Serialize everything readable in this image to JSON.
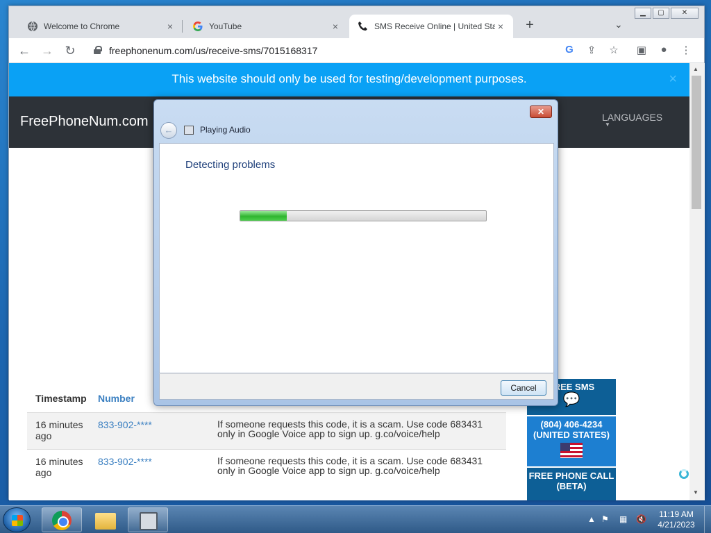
{
  "browser": {
    "tabs": [
      {
        "title": "Welcome to Chrome",
        "icon": "globe-icon",
        "close": "×"
      },
      {
        "title": "YouTube",
        "icon": "google-icon",
        "close": "×"
      },
      {
        "title": "SMS Receive Online | United Stat",
        "icon": "phone-icon",
        "close": "×"
      }
    ],
    "new_tab": "+",
    "url": "freephonenum.com/us/receive-sms/7015168317"
  },
  "page": {
    "banner_text": "This website should only be used for testing/development purposes.",
    "banner_close": "×",
    "brand": "FreePhoneNum.com",
    "languages": "LANGUAGES",
    "table": {
      "headers": [
        "Timestamp",
        "Number"
      ],
      "rows": [
        {
          "timestamp": "16 minutes ago",
          "number": "833-902-****",
          "message": "If someone requests this code, it is a scam. Use code 683431 only in Google Voice app to sign up. g.co/voice/help"
        },
        {
          "timestamp": "16 minutes ago",
          "number": "833-902-****",
          "message": "If someone requests this code, it is a scam. Use code 683431 only in Google Voice app to sign up. g.co/voice/help"
        }
      ]
    },
    "ads": {
      "free_sms": "FREE SMS",
      "phone": "(804) 406-4234",
      "country": "(UNITED STATES)",
      "free_call": "FREE PHONE CALL (BETA)"
    }
  },
  "dialog": {
    "title": "Playing Audio",
    "heading": "Detecting problems",
    "progress": 0.19,
    "cancel_label": "Cancel",
    "close": "✕"
  },
  "taskbar": {
    "time": "11:19 AM",
    "date": "4/21/2023"
  },
  "colors": {
    "banner": "#0aa1f5",
    "navbar": "#2d3238",
    "progress_green": "#2fb52f"
  }
}
